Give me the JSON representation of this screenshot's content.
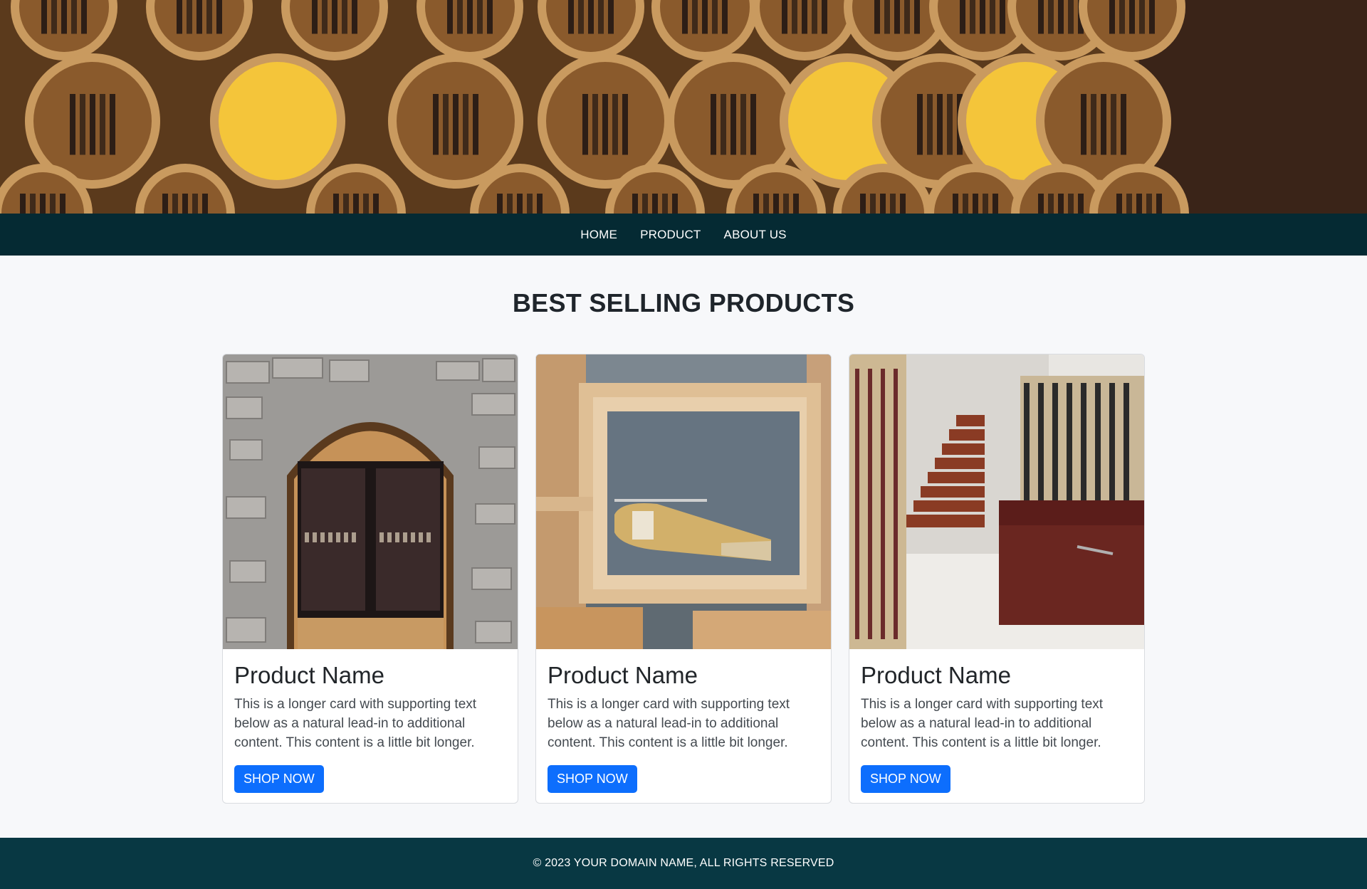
{
  "nav": {
    "items": [
      {
        "label": "HOME"
      },
      {
        "label": "PRODUCT"
      },
      {
        "label": "ABOUT US"
      }
    ]
  },
  "section": {
    "title": "BEST SELLING PRODUCTS"
  },
  "products": [
    {
      "name": "Product Name",
      "description": "This is a longer card with supporting text below as a natural lead-in to additional content. This content is a little bit longer.",
      "button_label": "SHOP NOW"
    },
    {
      "name": "Product Name",
      "description": "This is a longer card with supporting text below as a natural lead-in to additional content. This content is a little bit longer.",
      "button_label": "SHOP NOW"
    },
    {
      "name": "Product Name",
      "description": "This is a longer card with supporting text below as a natural lead-in to additional content. This content is a little bit longer.",
      "button_label": "SHOP NOW"
    }
  ],
  "footer": {
    "text": "© 2023 YOUR DOMAIN NAME, ALL RIGHTS RESERVED"
  },
  "colors": {
    "nav_bg": "#052a33",
    "footer_bg": "#083843",
    "button_bg": "#0d6efd",
    "page_bg": "#f7f8fa"
  }
}
